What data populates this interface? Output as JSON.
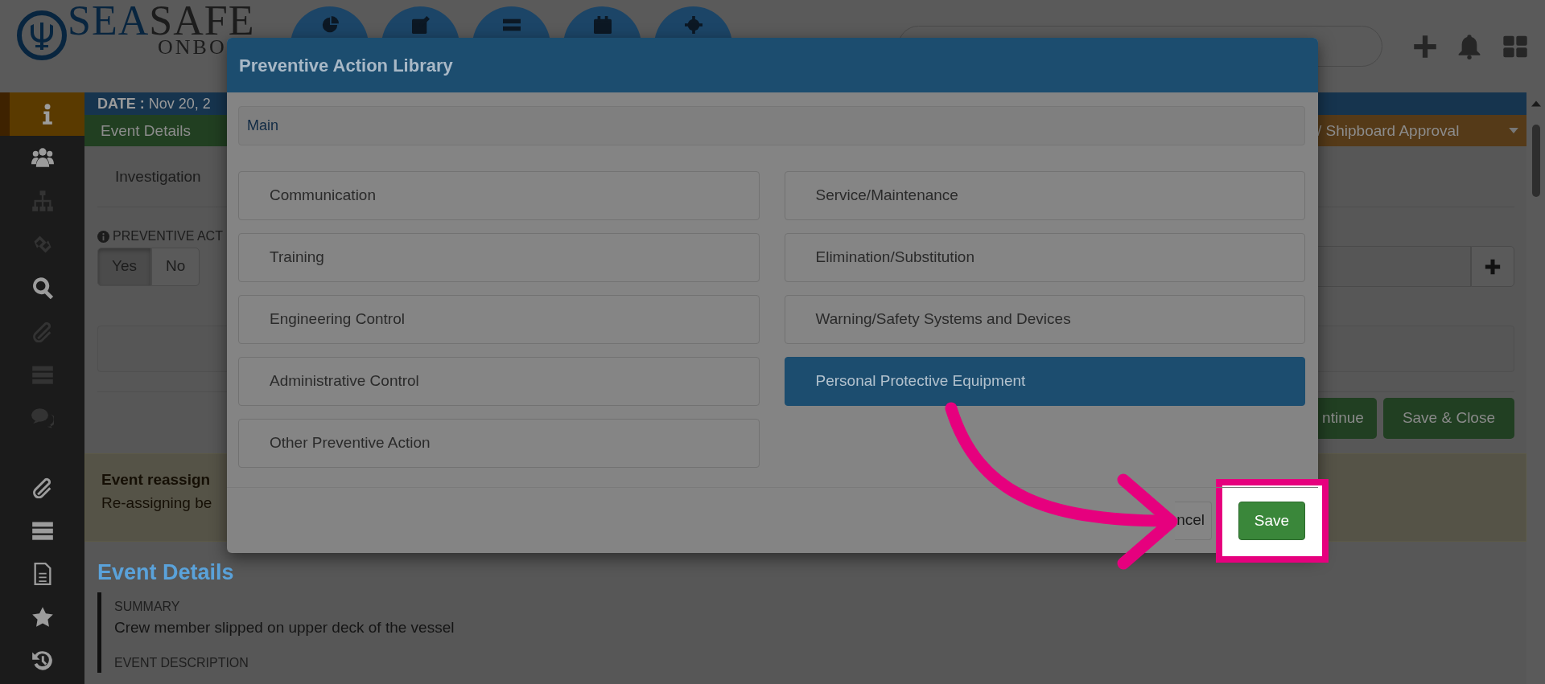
{
  "header": {
    "logo": {
      "part_1": "SEA",
      "part_2": "SAFE",
      "subtitle": "ONBO"
    }
  },
  "sidebar": {
    "groups": [
      [
        {
          "selected": true,
          "disabled": false
        },
        {
          "selected": false,
          "disabled": false
        },
        {
          "selected": false,
          "disabled": true
        },
        {
          "selected": false,
          "disabled": true
        },
        {
          "selected": false,
          "disabled": false
        },
        {
          "selected": false,
          "disabled": true
        },
        {
          "selected": false,
          "disabled": true
        },
        {
          "selected": false,
          "disabled": true
        }
      ],
      [
        {
          "selected": false,
          "disabled": false
        },
        {
          "selected": false,
          "disabled": false
        },
        {
          "selected": false,
          "disabled": false
        },
        {
          "selected": false,
          "disabled": false
        },
        {
          "selected": false,
          "disabled": false
        }
      ]
    ]
  },
  "date_bar": "**DATE :** Nov 20, 2",
  "workflow": {
    "first_step": "Event Details",
    "last_step": "/ Shipboard Approval"
  },
  "investigation_tab": "Investigation",
  "preventive_label": "PREVENTIVE ACT",
  "toggle": [
    {
      "label": "Yes",
      "selected": true
    },
    {
      "label": "No",
      "selected": false
    }
  ],
  "actions": [
    {
      "label": "ntinue"
    },
    {
      "label": "Save & Close"
    }
  ],
  "alert": {
    "title": "Event reassign",
    "text": "Re-assigning be"
  },
  "event_details": {
    "heading": "Event Details",
    "fields": [
      {
        "label": "SUMMARY",
        "value": "Crew member slipped on upper deck of the vessel"
      },
      {
        "label": "EVENT DESCRIPTION"
      }
    ]
  },
  "modal": {
    "title": "Preventive Action Library",
    "search": {
      "placeholder": "Main"
    },
    "options": [
      {
        "label": "Communication",
        "selected": false
      },
      {
        "label": "Service/Maintenance",
        "selected": false
      },
      {
        "label": "Training",
        "selected": false
      },
      {
        "label": "Elimination/Substitution",
        "selected": false
      },
      {
        "label": "Engineering Control",
        "selected": false
      },
      {
        "label": "Warning/Safety Systems and Devices",
        "selected": false
      },
      {
        "label": "Administrative Control",
        "selected": false
      },
      {
        "label": "Personal Protective Equipment",
        "selected": true
      },
      {
        "label": "Other Preventive Action",
        "selected": false
      }
    ],
    "buttons": [
      {
        "label": "ncel",
        "kind": "cancel",
        "highlighted": false
      },
      {
        "label": "Save",
        "kind": "save",
        "highlighted": true
      }
    ]
  }
}
